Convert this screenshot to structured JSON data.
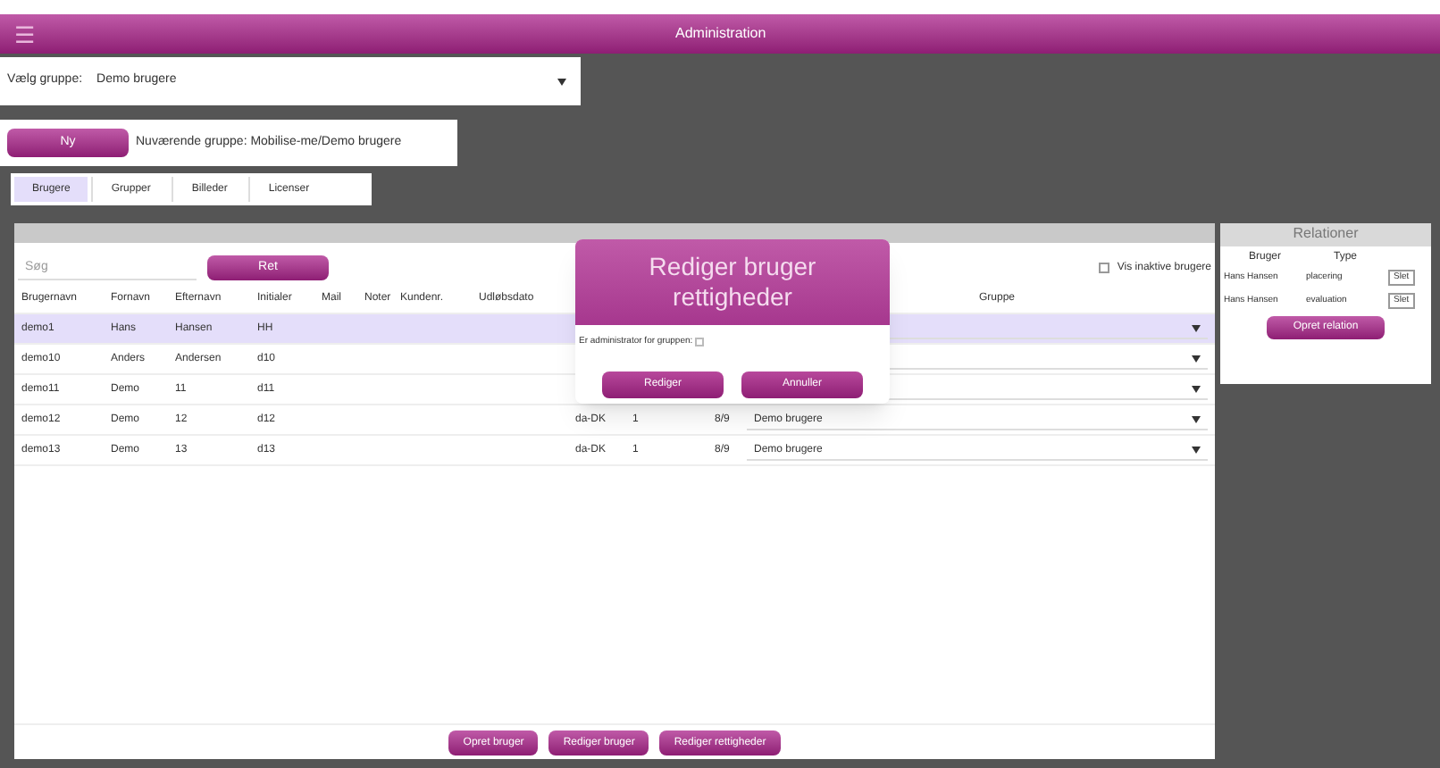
{
  "header": {
    "menu_icon": "☰",
    "title": "Administration"
  },
  "group_select": {
    "label": "Vælg gruppe:",
    "value": "Demo brugere"
  },
  "group_bar": {
    "new_button": "Ny",
    "current_group": "Nuværende gruppe: Mobilise-me/Demo brugere"
  },
  "tabs": [
    {
      "label": "Brugere",
      "selected": true
    },
    {
      "label": "Grupper",
      "selected": false
    },
    {
      "label": "Billeder",
      "selected": false
    },
    {
      "label": "Licenser",
      "selected": false
    }
  ],
  "users": {
    "search": {
      "placeholder": "Søg"
    },
    "search_button": "Ret",
    "show_inactive": {
      "label": "Vis inaktive brugere",
      "checked": false
    },
    "columns": [
      "Brugernavn",
      "Fornavn",
      "Efternavn",
      "Initialer",
      "Mail",
      "Noter",
      "Kundenr.",
      "Udløbsdato"
    ],
    "group_column": "Gruppe",
    "rows": [
      {
        "cells": [
          "demo1",
          "Hans",
          "Hansen",
          "HH"
        ],
        "selected": true
      },
      {
        "cells": [
          "demo10",
          "Anders",
          "Andersen",
          "d10"
        ],
        "selected": false
      },
      {
        "cells": [
          "demo11",
          "Demo",
          "11",
          "d11"
        ],
        "selected": false
      },
      {
        "cells": [
          "demo12",
          "Demo",
          "12",
          "d12"
        ],
        "selected": false,
        "extra": [
          "da-DK",
          "1",
          "8/9"
        ],
        "group": "Demo brugere"
      },
      {
        "cells": [
          "demo13",
          "Demo",
          "13",
          "d13"
        ],
        "selected": false,
        "extra": [
          "da-DK",
          "1",
          "8/9"
        ],
        "group": "Demo brugere"
      }
    ],
    "buttons": [
      "Opret bruger",
      "Rediger bruger",
      "Rediger rettigheder"
    ]
  },
  "dialog": {
    "title": "Rediger bruger rettigheder",
    "checkbox": {
      "label": "Er administrator for gruppen:",
      "checked": false
    },
    "buttons": [
      "Rediger",
      "Annuller"
    ]
  },
  "relations": {
    "title": "Relationer",
    "columns": [
      "Bruger",
      "Type"
    ],
    "rows": [
      {
        "user": "Hans Hansen",
        "type": "placering",
        "action": "Slet"
      },
      {
        "user": "Hans Hansen",
        "type": "evaluation",
        "action": "Slet"
      }
    ],
    "button": "Opret relation"
  }
}
